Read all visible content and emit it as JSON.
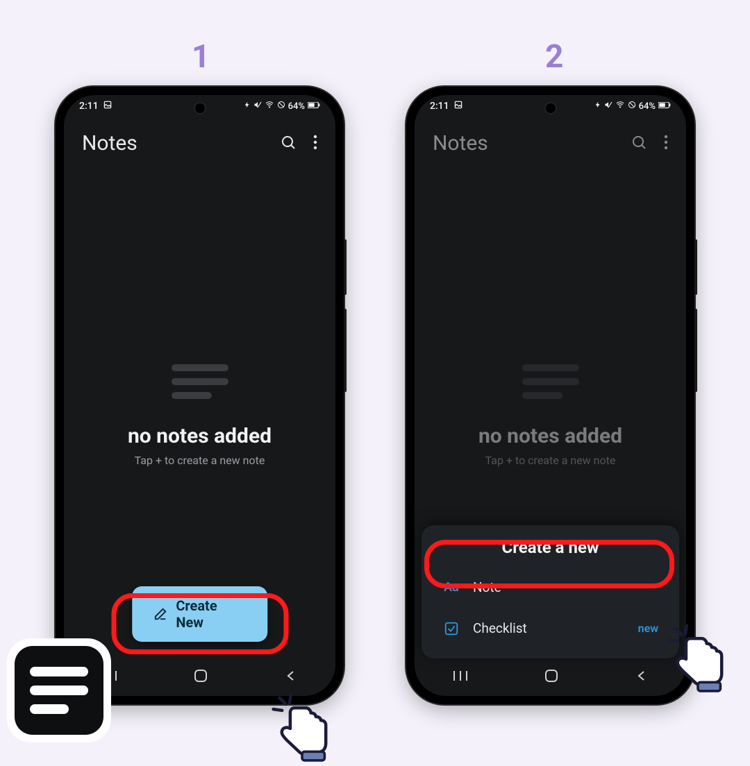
{
  "steps": {
    "one": "1",
    "two": "2"
  },
  "status": {
    "time": "2:11",
    "battery": "64%"
  },
  "header": {
    "title": "Notes"
  },
  "empty": {
    "title": "no notes added",
    "subtitle": "Tap + to create a new note"
  },
  "create_button": "Create New",
  "sheet": {
    "title": "Create a new",
    "note_label": "Note",
    "note_icon_text": "Aa",
    "checklist_label": "Checklist",
    "checklist_badge": "new"
  }
}
